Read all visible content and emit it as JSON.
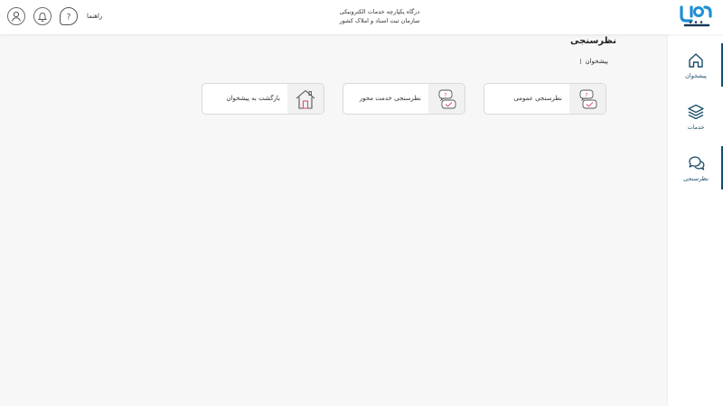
{
  "header": {
    "title_line1": "درگاه یکپارچه خدمات الکترونیکی",
    "title_line2": "سازمان ثبت اسناد و املاک کشور",
    "help_label": "راهنما",
    "icons": [
      "user-icon",
      "bell-icon",
      "help-icon"
    ]
  },
  "sidebar": {
    "items": [
      {
        "label": "پیشخوان",
        "icon": "home-icon",
        "active": true
      },
      {
        "label": "خدمات",
        "icon": "layers-icon",
        "active": false
      },
      {
        "label": "نظرسنجی",
        "icon": "chat-icon",
        "active": true
      }
    ]
  },
  "main": {
    "page_title": "نظرسنجی",
    "breadcrumb": [
      "پیشخوان"
    ],
    "cards": [
      {
        "label": "نظرسنجی عمومی",
        "icon": "survey-icon"
      },
      {
        "label": "نظرسنجی خدمت محور",
        "icon": "survey-icon"
      },
      {
        "label": "بازگشت به پیشخوان",
        "icon": "house-icon"
      }
    ]
  },
  "colors": {
    "accent": "#134e6f",
    "logo_blue": "#1e8fd6",
    "icon_red": "#e0506a",
    "background": "#f7f7f7"
  }
}
